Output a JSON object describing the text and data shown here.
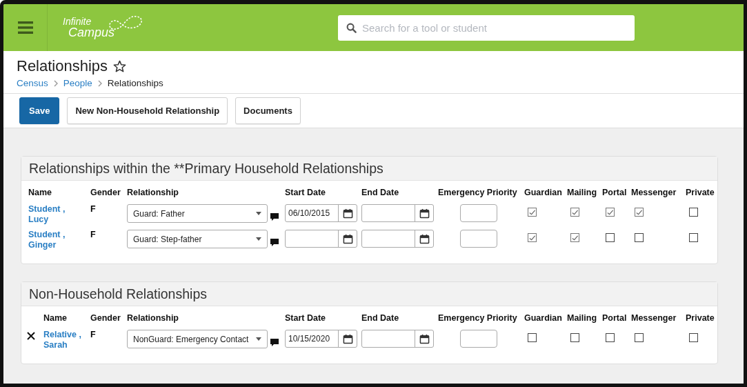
{
  "header": {
    "logo": {
      "line1": "Infinite",
      "line2": "Campus"
    },
    "search": {
      "placeholder": "Search for a tool or student"
    }
  },
  "page": {
    "title": "Relationships",
    "starred": false,
    "breadcrumb": [
      {
        "label": "Census",
        "link": true
      },
      {
        "label": "People",
        "link": true
      },
      {
        "label": "Relationships",
        "link": false
      }
    ]
  },
  "toolbar": [
    {
      "label": "Save",
      "kind": "primary"
    },
    {
      "label": "New Non-Household Relationship",
      "kind": "secondary"
    },
    {
      "label": "Documents",
      "kind": "secondary"
    }
  ],
  "sections": [
    {
      "title": "Relationships within the **Primary Household Relationships",
      "kind": "household",
      "columns": [
        "Name",
        "Gender",
        "Relationship",
        "Start Date",
        "End Date",
        "Emergency Priority",
        "Guardian",
        "Mailing",
        "Portal",
        "Messenger",
        "Private"
      ],
      "rows": [
        {
          "name": "Student , Lucy",
          "gender": "F",
          "relationship": "Guard: Father",
          "start_date": "06/10/2015",
          "guardian": true,
          "mailing": true,
          "portal": true,
          "messenger": true,
          "private": false
        },
        {
          "name": "Student , Ginger",
          "gender": "F",
          "relationship": "Guard: Step-father",
          "guardian": true,
          "mailing": true,
          "portal": false,
          "messenger": false,
          "private": false
        }
      ]
    },
    {
      "title": "Non-Household Relationships",
      "kind": "non_household",
      "columns": [
        "Name",
        "Gender",
        "Relationship",
        "Start Date",
        "End Date",
        "Emergency Priority",
        "Guardian",
        "Mailing",
        "Portal",
        "Messenger",
        "Private"
      ],
      "rows": [
        {
          "name": "Relative , Sarah",
          "gender": "F",
          "relationship": "NonGuard: Emergency Contact",
          "start_date": "10/15/2020",
          "guardian": false,
          "mailing": false,
          "portal": false,
          "messenger": false,
          "private": false
        }
      ]
    }
  ]
}
